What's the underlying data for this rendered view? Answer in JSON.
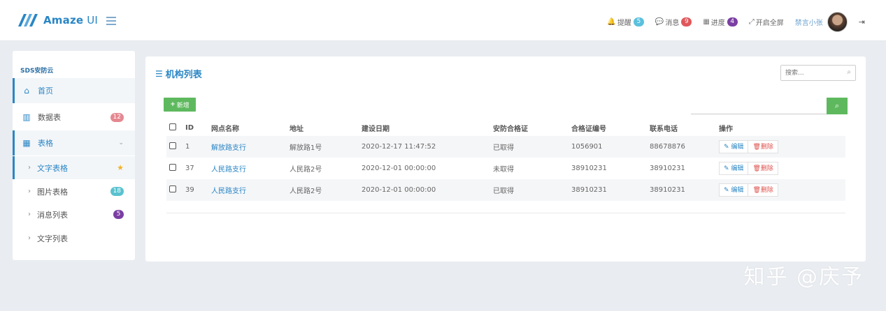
{
  "header": {
    "brand": "Amaze",
    "brand_suffix": " UI",
    "nav": [
      {
        "icon": "bell-icon",
        "glyph": "🔔",
        "label": "提醒",
        "badge": "5",
        "badge_color": "#5bc0de"
      },
      {
        "icon": "comment-icon",
        "glyph": "💬",
        "label": "消息",
        "badge": "9",
        "badge_color": "#e0575b"
      },
      {
        "icon": "calendar-icon",
        "glyph": "▦",
        "label": "进度",
        "badge": "4",
        "badge_color": "#7b3ea3"
      },
      {
        "icon": "expand-icon",
        "glyph": "⤢",
        "label": "开启全屏"
      }
    ],
    "user": "禁言小张"
  },
  "sidebar": {
    "title": "SDS安防云",
    "items": [
      {
        "label": "首页",
        "icon": "home-icon"
      },
      {
        "label": "数据表",
        "icon": "bar-chart-icon",
        "badge": "12"
      },
      {
        "label": "表格",
        "icon": "table-icon"
      }
    ],
    "sub_items": [
      {
        "label": "文字表格"
      },
      {
        "label": "图片表格",
        "badge": "18"
      },
      {
        "label": "消息列表",
        "badge": "5"
      },
      {
        "label": "文字列表"
      }
    ]
  },
  "main": {
    "title": "机构列表",
    "search_placeholder": "搜索...",
    "add_label": "新增",
    "columns": [
      "ID",
      "网点名称",
      "地址",
      "建设日期",
      "安防合格证",
      "合格证编号",
      "联系电话",
      "操作"
    ],
    "rows": [
      {
        "id": "1",
        "name": "解放路支行",
        "address": "解放路1号",
        "date": "2020-12-17 11:47:52",
        "cert": "已取得",
        "cert_no": "1056901",
        "phone": "88678876"
      },
      {
        "id": "37",
        "name": "人民路支行",
        "address": "人民路2号",
        "date": "2020-12-01 00:00:00",
        "cert": "未取得",
        "cert_no": "38910231",
        "phone": "38910231"
      },
      {
        "id": "39",
        "name": "人民路支行",
        "address": "人民路2号",
        "date": "2020-12-01 00:00:00",
        "cert": "已取得",
        "cert_no": "38910231",
        "phone": "38910231"
      }
    ],
    "edit_label": "编辑",
    "delete_label": "删除"
  },
  "watermark": "知乎 @庆予"
}
